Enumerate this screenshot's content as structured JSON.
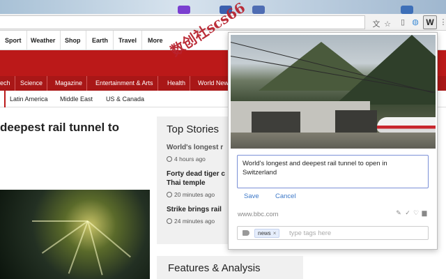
{
  "browser": {
    "icons": [
      "translate-icon",
      "star-icon",
      "extension-icon",
      "extension-circle-icon",
      "menu-icon"
    ],
    "extension_label": "W"
  },
  "bbc_nav": {
    "items": [
      "Sport",
      "Weather",
      "Shop",
      "Earth",
      "Travel",
      "More"
    ]
  },
  "news_nav": {
    "items": [
      "ech",
      "Science",
      "Magazine",
      "Entertainment & Arts",
      "Health",
      "World News"
    ]
  },
  "sub_nav": {
    "items": [
      "Latin America",
      "Middle East",
      "US & Canada"
    ]
  },
  "main": {
    "headline_line1": "deepest rail tunnel to"
  },
  "top_stories": {
    "title": "Top Stories",
    "stories": [
      {
        "title": "World's longest r",
        "time": "4 hours ago"
      },
      {
        "title": "Forty dead tiger c",
        "title2": "Thai temple",
        "time": "20 minutes ago"
      },
      {
        "title": "Strike brings rail",
        "time": "24 minutes ago"
      }
    ]
  },
  "features": {
    "title": "Features & Analysis"
  },
  "popup": {
    "note_text": "World's longest and deepest rail tunnel to open in Switzerland",
    "save_label": "Save",
    "cancel_label": "Cancel",
    "domain": "www.bbc.com",
    "tags": [
      "news"
    ],
    "tag_placeholder": "type tags here",
    "action_icons": [
      "pencil-icon",
      "check-icon",
      "heart-icon",
      "trash-icon"
    ]
  },
  "watermark": {
    "text": "数创社scs66"
  },
  "colors": {
    "bbc_red": "#bb1919",
    "link_blue": "#3c78c8",
    "input_focus": "#7a8fd6"
  }
}
